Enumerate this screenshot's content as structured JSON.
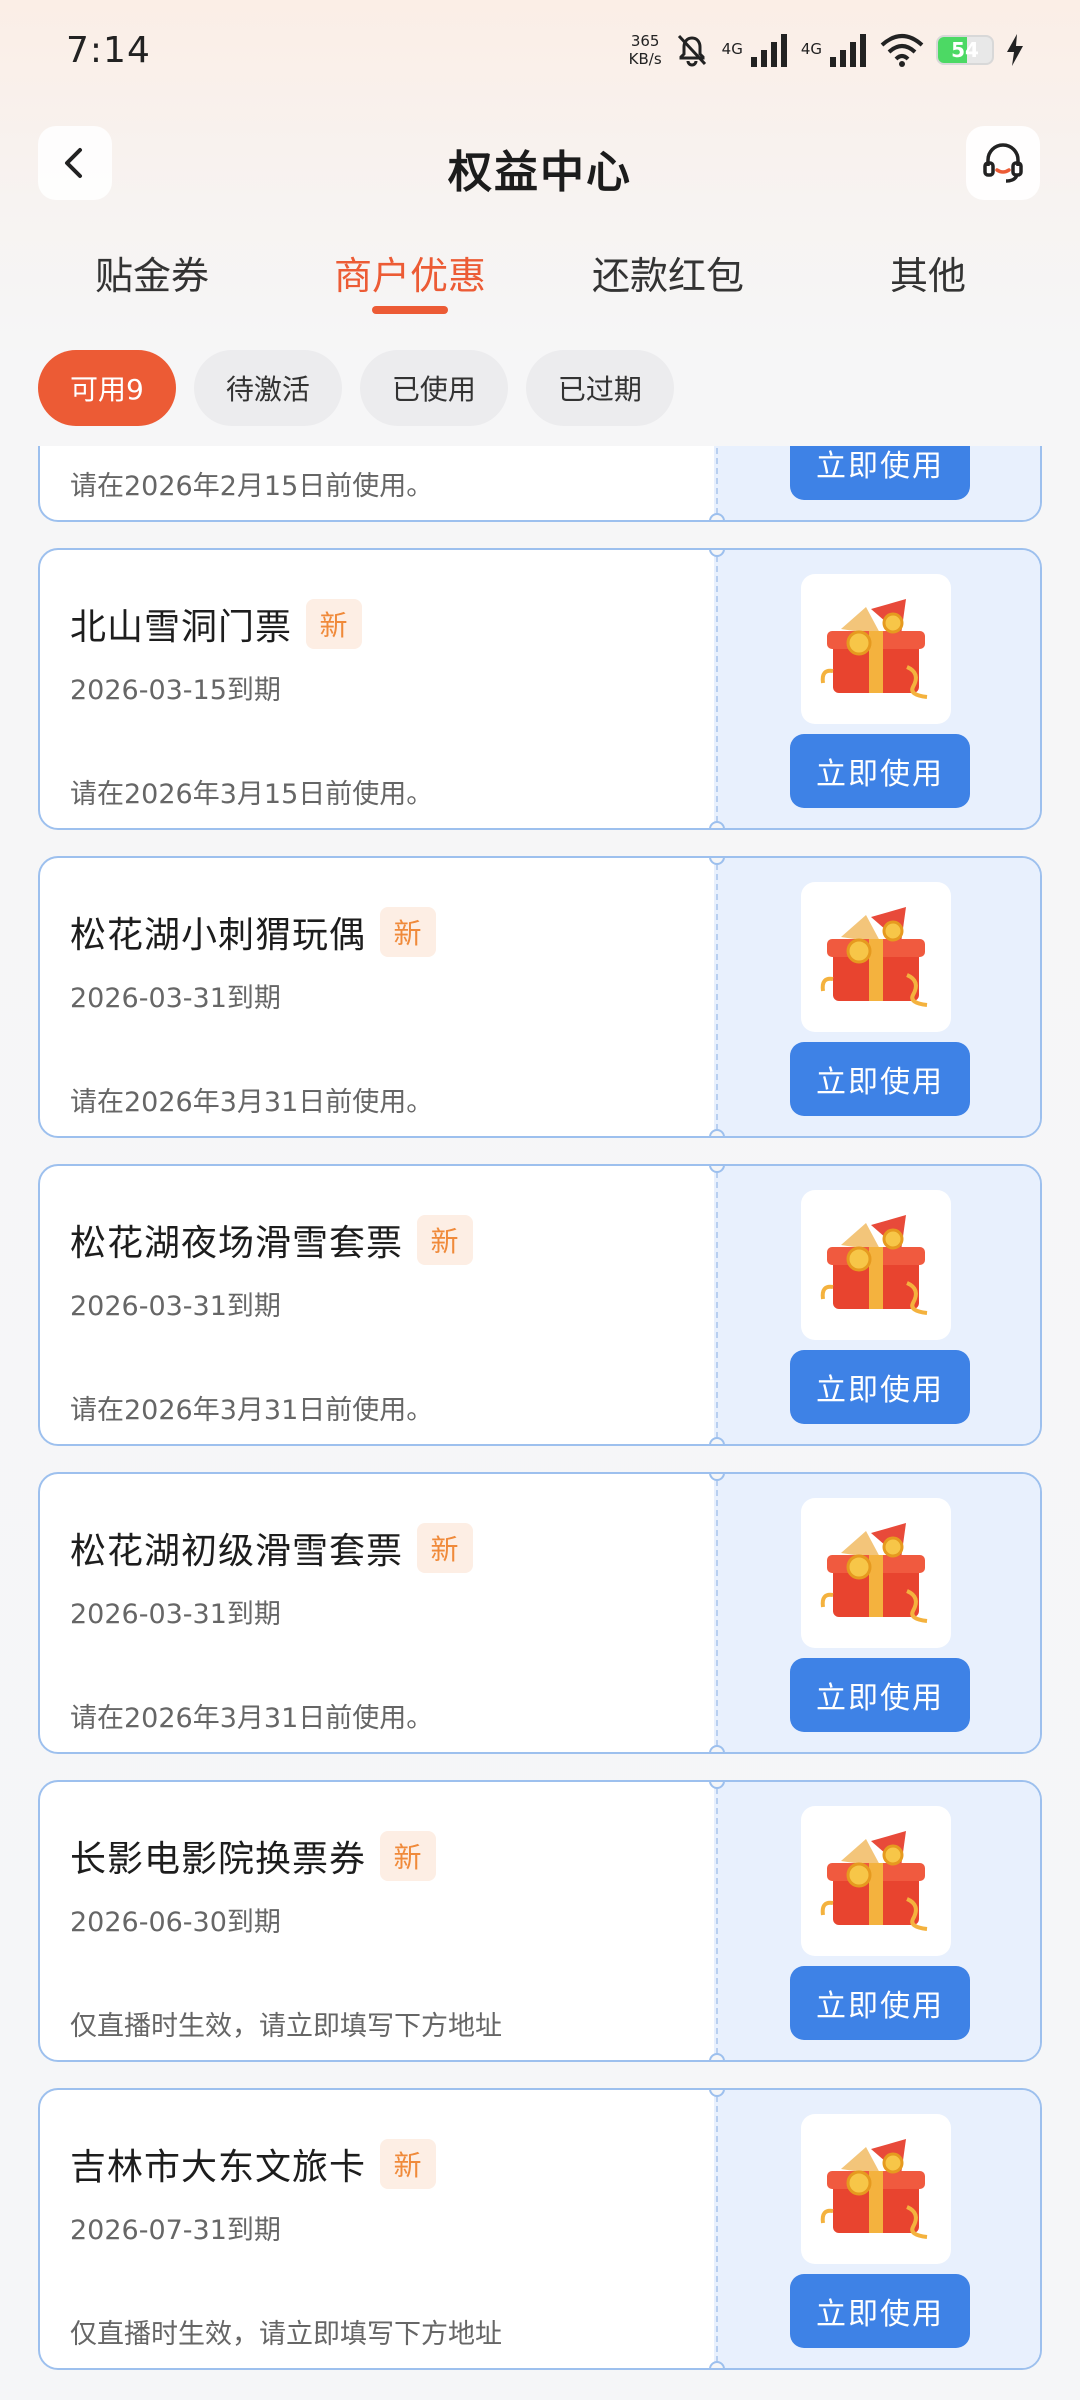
{
  "status_bar": {
    "time": "7:14",
    "net_speed_value": "365",
    "net_speed_unit": "KB/s",
    "signal1_label": "4G",
    "signal2_label": "4G",
    "battery_level": "54"
  },
  "header": {
    "title": "权益中心"
  },
  "tabs": [
    {
      "label": "贴金券"
    },
    {
      "label": "商户优惠"
    },
    {
      "label": "还款红包"
    },
    {
      "label": "其他"
    }
  ],
  "active_tab_index": 1,
  "filters": [
    {
      "label": "可用9"
    },
    {
      "label": "待激活"
    },
    {
      "label": "已使用"
    },
    {
      "label": "已过期"
    }
  ],
  "coupons": {
    "partial": {
      "note": "请在2026年2月15日前使用。",
      "button": "立即使用"
    },
    "items": [
      {
        "title": "北山雪洞门票",
        "badge": "新",
        "expire": "2026-03-15到期",
        "note": "请在2026年3月15日前使用。",
        "button": "立即使用"
      },
      {
        "title": "松花湖小刺猬玩偶",
        "badge": "新",
        "expire": "2026-03-31到期",
        "note": "请在2026年3月31日前使用。",
        "button": "立即使用"
      },
      {
        "title": "松花湖夜场滑雪套票",
        "badge": "新",
        "expire": "2026-03-31到期",
        "note": "请在2026年3月31日前使用。",
        "button": "立即使用"
      },
      {
        "title": "松花湖初级滑雪套票",
        "badge": "新",
        "expire": "2026-03-31到期",
        "note": "请在2026年3月31日前使用。",
        "button": "立即使用"
      },
      {
        "title": "长影电影院换票券",
        "badge": "新",
        "expire": "2026-06-30到期",
        "note": "仅直播时生效，请立即填写下方地址",
        "button": "立即使用"
      },
      {
        "title": "吉林市大东文旅卡",
        "badge": "新",
        "expire": "2026-07-31到期",
        "note": "仅直播时生效，请立即填写下方地址",
        "button": "立即使用"
      }
    ]
  },
  "colors": {
    "accent": "#ec5b35",
    "button_blue": "#3e82e6",
    "badge_text": "#f08a3a",
    "coupon_border": "#9dc0ee",
    "coupon_right_bg": "#e8f0fd"
  }
}
